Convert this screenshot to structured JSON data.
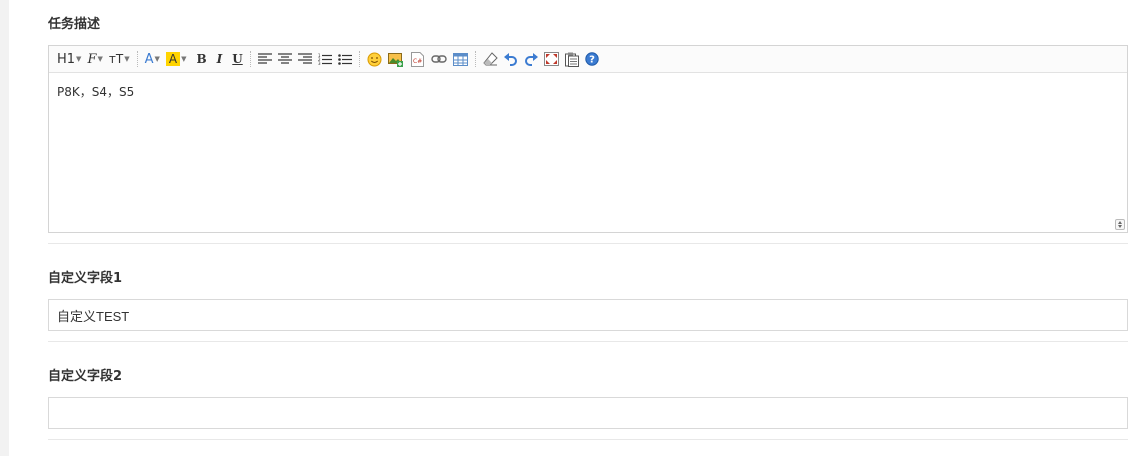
{
  "task_description": {
    "label": "任务描述",
    "content": "P8K，S4，S5",
    "toolbar": {
      "heading": "H1",
      "font_family": "F",
      "font_size": "тT",
      "font_color": "A",
      "bg_color": "A",
      "bold": "B",
      "italic": "I",
      "underline": "U"
    }
  },
  "custom_field_1": {
    "label": "自定义字段1",
    "value": "自定义TEST",
    "placeholder": ""
  },
  "custom_field_2": {
    "label": "自定义字段2",
    "value": "",
    "placeholder": ""
  },
  "colors": {
    "icon_blue": "#3b7bd1",
    "highlight_yellow": "#ffd400",
    "border": "#d4d4d4"
  }
}
